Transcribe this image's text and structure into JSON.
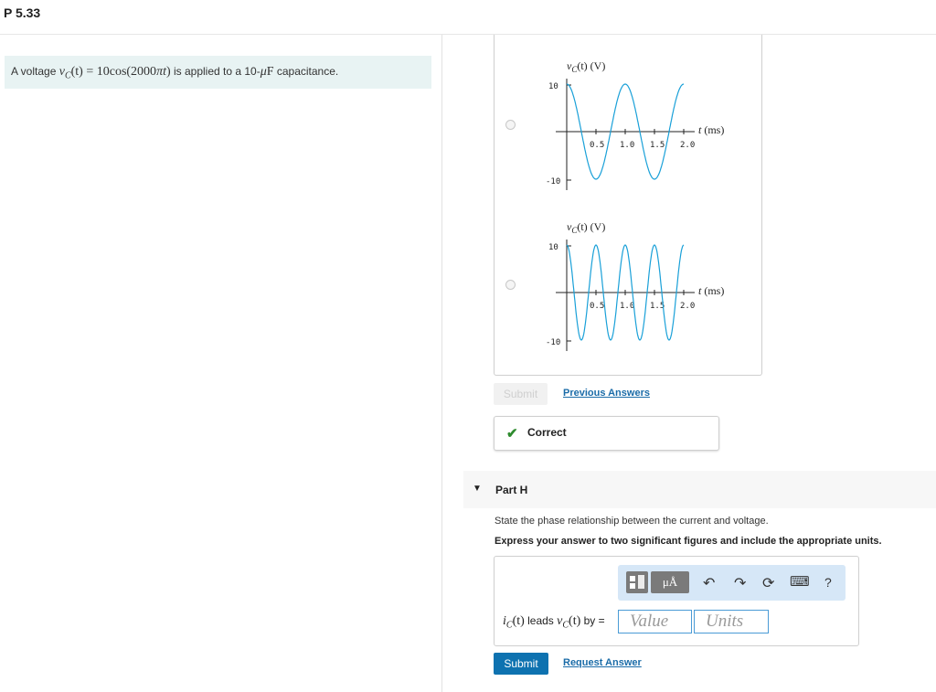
{
  "page": {
    "title": "P 5.33"
  },
  "problem": {
    "prefix": "A voltage ",
    "v": "v",
    "v_sub": "C",
    "arg": "(t)",
    "eq": " = 10cos(2000",
    "pi": "π",
    "t_close": "t",
    "close": ")",
    "mid": " is applied to a 10-",
    "mu": "μ",
    "F": "F",
    "suffix": " capacitance."
  },
  "choices": [
    {
      "ylabel": "vC(t) (V)",
      "xlabel": "t (ms)",
      "y_ticks": [
        "10",
        "-10"
      ],
      "x_ticks": [
        "0.5",
        "1.0",
        "1.5",
        "2.0"
      ]
    },
    {
      "ylabel": "vC(t) (V)",
      "xlabel": "t (ms)",
      "y_ticks": [
        "10",
        "-10"
      ],
      "x_ticks": [
        "0.5",
        "1.0",
        "1.5",
        "2.0"
      ]
    }
  ],
  "prev": {
    "submit_label": "Submit",
    "previous_answers": "Previous Answers",
    "feedback": "Correct"
  },
  "part_h": {
    "title": "Part H",
    "question": "State the phase relationship between the current and voltage.",
    "instruction": "Express your answer to two significant figures and include the appropriate units.",
    "toolbar": {
      "units_button": "μÅ",
      "help": "?"
    },
    "answer": {
      "i": "i",
      "i_sub": "C",
      "targ": "(t)",
      "leads": " leads ",
      "v": "v",
      "v_sub": "C",
      "vt": "(t)",
      "by": " by ="
    },
    "value_placeholder": "Value",
    "units_placeholder": "Units",
    "submit_label": "Submit",
    "request_answer": "Request Answer"
  },
  "colors": {
    "curve": "#19a0d8",
    "link": "#1b6ca8",
    "submit": "#0e72b0",
    "correct": "#2e8b2e"
  }
}
